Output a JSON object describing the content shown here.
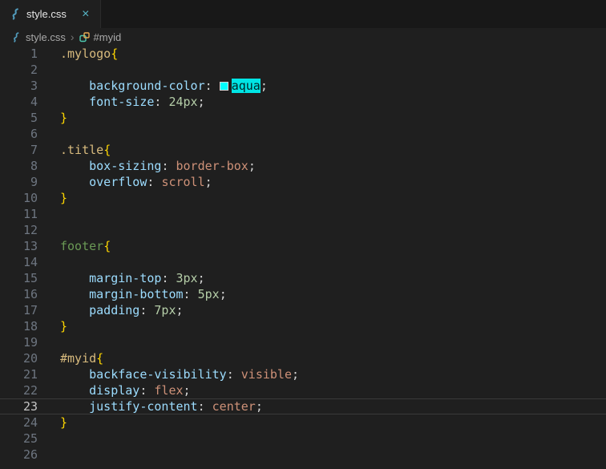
{
  "tab_bar": {
    "active_tab": {
      "label": "style.css",
      "close_glyph": "×"
    }
  },
  "breadcrumbs": {
    "separator": "›",
    "items": [
      {
        "label": "style.css",
        "icon": "css-file-icon"
      },
      {
        "label": "#myid",
        "icon": "symbol-rule-icon"
      }
    ]
  },
  "editor": {
    "language": "css",
    "current_line": 23,
    "total_lines": 26,
    "palette": {
      "background": "#1f1f1f",
      "tab_strip_background": "#181818",
      "gutter_foreground": "#6e7681",
      "gutter_active_foreground": "#c6c6c6",
      "selector_class": "#d7ba7d",
      "selector_id": "#d7ba7d",
      "selector_tag": "#6a9955",
      "property": "#9cdcfe",
      "value_keyword": "#ce9178",
      "number": "#b5cea8",
      "punctuation": "#d4d4d4",
      "brace": "#ffd700",
      "selection_background": "#00e5e5",
      "selection_foreground": "#002626",
      "swatch_color": "#00ffff",
      "file_icon_color": "#519aba"
    },
    "lines": [
      {
        "n": 1,
        "tokens": [
          {
            "t": ".mylogo",
            "c": "selector_class"
          },
          {
            "t": "{",
            "c": "brace"
          }
        ]
      },
      {
        "n": 2,
        "tokens": []
      },
      {
        "n": 3,
        "tokens": [
          {
            "t": "    ",
            "c": "punctuation"
          },
          {
            "t": "background-color",
            "c": "property"
          },
          {
            "t": ": ",
            "c": "punctuation"
          },
          {
            "swatch": true
          },
          {
            "t": "aqua",
            "c": "selection"
          },
          {
            "t": ";",
            "c": "punctuation"
          }
        ]
      },
      {
        "n": 4,
        "tokens": [
          {
            "t": "    ",
            "c": "punctuation"
          },
          {
            "t": "font-size",
            "c": "property"
          },
          {
            "t": ": ",
            "c": "punctuation"
          },
          {
            "t": "24px",
            "c": "number"
          },
          {
            "t": ";",
            "c": "punctuation"
          }
        ]
      },
      {
        "n": 5,
        "tokens": [
          {
            "t": "}",
            "c": "brace"
          }
        ]
      },
      {
        "n": 6,
        "tokens": []
      },
      {
        "n": 7,
        "tokens": [
          {
            "t": ".title",
            "c": "selector_class"
          },
          {
            "t": "{",
            "c": "brace"
          }
        ]
      },
      {
        "n": 8,
        "tokens": [
          {
            "t": "    ",
            "c": "punctuation"
          },
          {
            "t": "box-sizing",
            "c": "property"
          },
          {
            "t": ": ",
            "c": "punctuation"
          },
          {
            "t": "border-box",
            "c": "value_keyword"
          },
          {
            "t": ";",
            "c": "punctuation"
          }
        ]
      },
      {
        "n": 9,
        "tokens": [
          {
            "t": "    ",
            "c": "punctuation"
          },
          {
            "t": "overflow",
            "c": "property"
          },
          {
            "t": ": ",
            "c": "punctuation"
          },
          {
            "t": "scroll",
            "c": "value_keyword"
          },
          {
            "t": ";",
            "c": "punctuation"
          }
        ]
      },
      {
        "n": 10,
        "tokens": [
          {
            "t": "}",
            "c": "brace"
          }
        ]
      },
      {
        "n": 11,
        "tokens": []
      },
      {
        "n": 12,
        "tokens": []
      },
      {
        "n": 13,
        "tokens": [
          {
            "t": "footer",
            "c": "selector_tag"
          },
          {
            "t": "{",
            "c": "brace"
          }
        ]
      },
      {
        "n": 14,
        "tokens": []
      },
      {
        "n": 15,
        "tokens": [
          {
            "t": "    ",
            "c": "punctuation"
          },
          {
            "t": "margin-top",
            "c": "property"
          },
          {
            "t": ": ",
            "c": "punctuation"
          },
          {
            "t": "3px",
            "c": "number"
          },
          {
            "t": ";",
            "c": "punctuation"
          }
        ]
      },
      {
        "n": 16,
        "tokens": [
          {
            "t": "    ",
            "c": "punctuation"
          },
          {
            "t": "margin-bottom",
            "c": "property"
          },
          {
            "t": ": ",
            "c": "punctuation"
          },
          {
            "t": "5px",
            "c": "number"
          },
          {
            "t": ";",
            "c": "punctuation"
          }
        ]
      },
      {
        "n": 17,
        "tokens": [
          {
            "t": "    ",
            "c": "punctuation"
          },
          {
            "t": "padding",
            "c": "property"
          },
          {
            "t": ": ",
            "c": "punctuation"
          },
          {
            "t": "7px",
            "c": "number"
          },
          {
            "t": ";",
            "c": "punctuation"
          }
        ]
      },
      {
        "n": 18,
        "tokens": [
          {
            "t": "}",
            "c": "brace"
          }
        ]
      },
      {
        "n": 19,
        "tokens": []
      },
      {
        "n": 20,
        "tokens": [
          {
            "t": "#myid",
            "c": "selector_id"
          },
          {
            "t": "{",
            "c": "brace"
          }
        ]
      },
      {
        "n": 21,
        "tokens": [
          {
            "t": "    ",
            "c": "punctuation"
          },
          {
            "t": "backface-visibility",
            "c": "property"
          },
          {
            "t": ": ",
            "c": "punctuation"
          },
          {
            "t": "visible",
            "c": "value_keyword"
          },
          {
            "t": ";",
            "c": "punctuation"
          }
        ]
      },
      {
        "n": 22,
        "tokens": [
          {
            "t": "    ",
            "c": "punctuation"
          },
          {
            "t": "display",
            "c": "property"
          },
          {
            "t": ": ",
            "c": "punctuation"
          },
          {
            "t": "flex",
            "c": "value_keyword"
          },
          {
            "t": ";",
            "c": "punctuation"
          }
        ]
      },
      {
        "n": 23,
        "tokens": [
          {
            "t": "    ",
            "c": "punctuation"
          },
          {
            "t": "justify-content",
            "c": "property"
          },
          {
            "t": ": ",
            "c": "punctuation"
          },
          {
            "t": "center",
            "c": "value_keyword"
          },
          {
            "t": ";",
            "c": "punctuation"
          }
        ]
      },
      {
        "n": 24,
        "tokens": [
          {
            "t": "}",
            "c": "brace"
          }
        ]
      },
      {
        "n": 25,
        "tokens": []
      },
      {
        "n": 26,
        "tokens": []
      }
    ]
  }
}
